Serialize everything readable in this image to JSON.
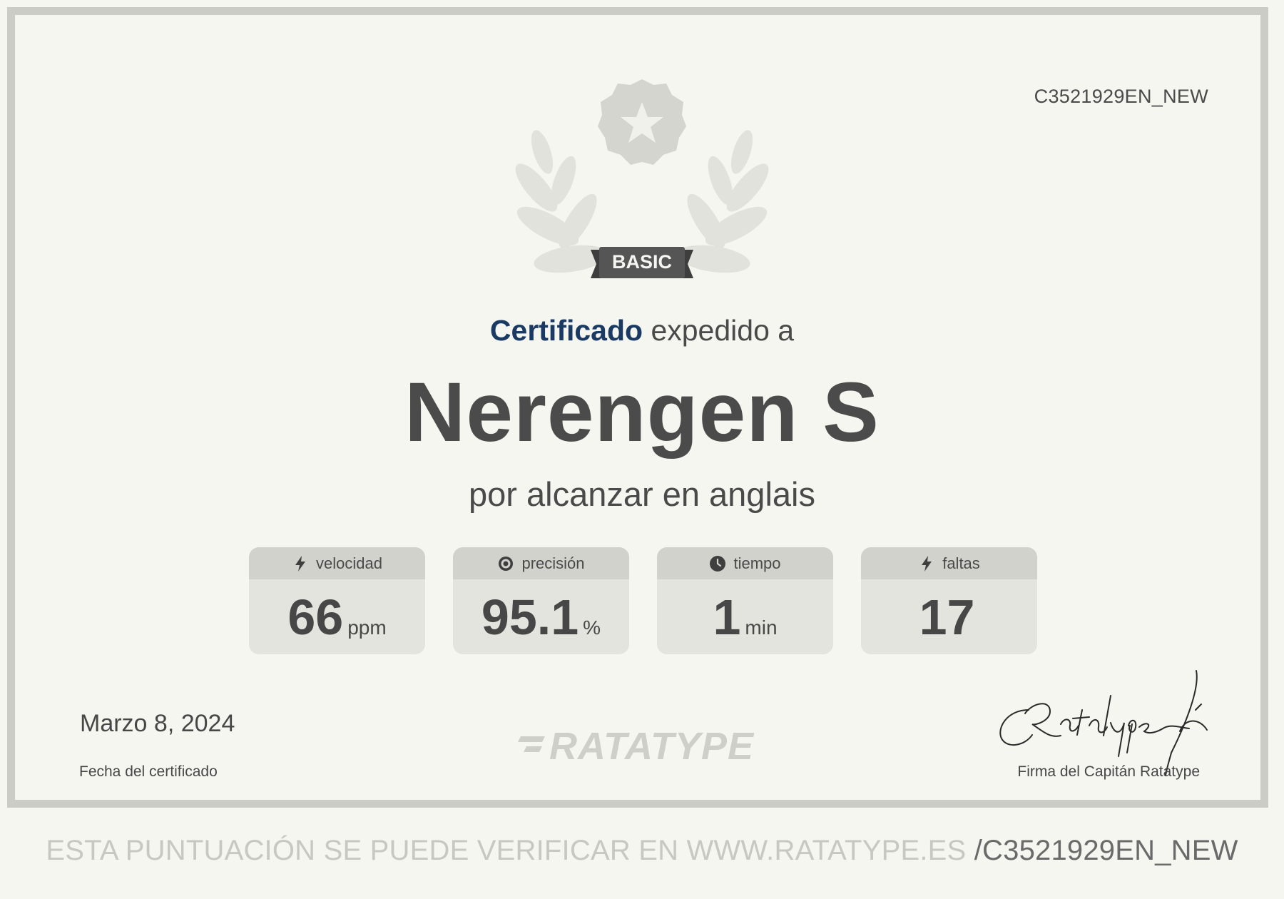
{
  "certificate": {
    "id": "C3521929EN_NEW",
    "badge_label": "BASIC",
    "title_strong": "Certificado",
    "title_rest": " expedido a",
    "recipient_name": "Nerengen S",
    "subtitle": "por alcanzar en anglais",
    "date": "Marzo 8, 2024",
    "date_label": "Fecha del certificado",
    "signature_label": "Firma del Capitán Ratatype"
  },
  "stats": [
    {
      "label": "velocidad",
      "value": "66",
      "unit": "ppm",
      "icon": "lightning-icon"
    },
    {
      "label": "precisión",
      "value": "95.1",
      "unit": "%",
      "icon": "target-icon"
    },
    {
      "label": "tiempo",
      "value": "1",
      "unit": "min",
      "icon": "clock-icon"
    },
    {
      "label": "faltas",
      "value": "17",
      "unit": "",
      "icon": "lightning-icon"
    }
  ],
  "brand": {
    "logo_text": "RATATYPE",
    "accent_color": "#1b3a63"
  },
  "footer": {
    "prefix": "ESTA PUNTUACIÓN SE PUEDE VERIFICAR EN WWW.RATATYPE.ES",
    "code": "/C3521929EN_NEW"
  }
}
